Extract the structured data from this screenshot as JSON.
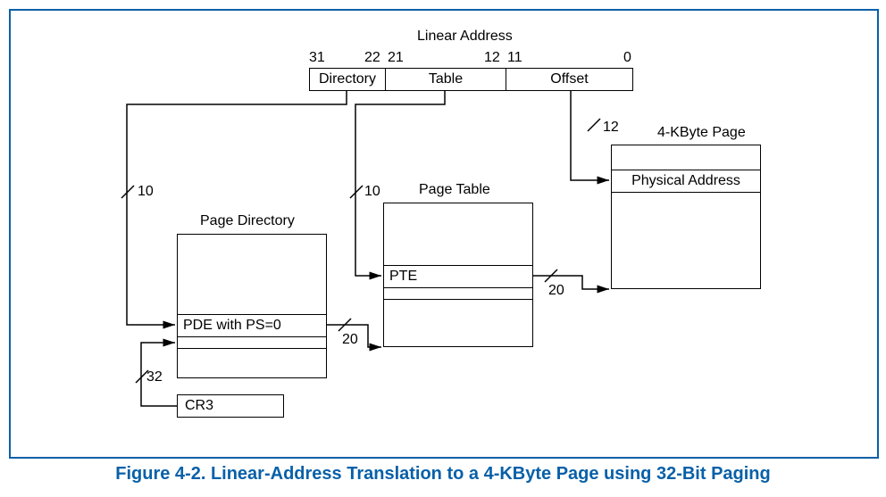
{
  "linear_address": {
    "title": "Linear Address",
    "fields": [
      {
        "name": "Directory",
        "hi": "31",
        "lo": "22"
      },
      {
        "name": "Table",
        "hi": "21",
        "lo": "12"
      },
      {
        "name": "Offset",
        "hi": "11",
        "lo": "0"
      }
    ]
  },
  "bit_widths": {
    "directory_to_pd": "10",
    "table_to_pt": "10",
    "offset_to_page": "12",
    "cr3_to_pd": "32",
    "pde_to_pt": "20",
    "pte_to_page": "20"
  },
  "structures": {
    "page_directory": {
      "title": "Page Directory",
      "entry": "PDE with PS=0"
    },
    "page_table": {
      "title": "Page Table",
      "entry": "PTE"
    },
    "page": {
      "title": "4-KByte Page",
      "entry": "Physical Address"
    },
    "cr3": {
      "label": "CR3"
    }
  },
  "caption": "Figure 4-2.  Linear-Address Translation to a 4-KByte Page using 32-Bit Paging"
}
